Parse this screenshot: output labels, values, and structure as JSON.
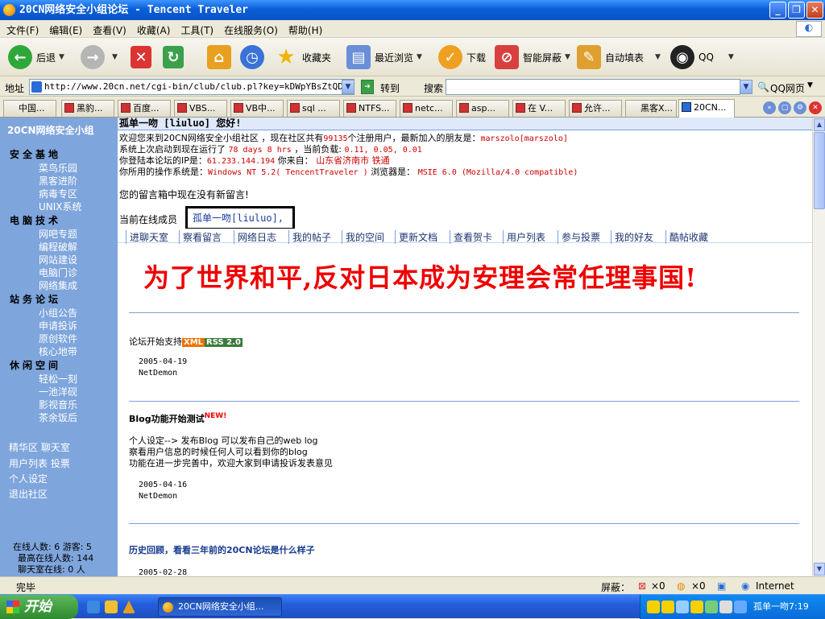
{
  "window": {
    "title": "20CN网络安全小组论坛 - Tencent Traveler",
    "controls": [
      "_",
      "❐",
      "✕"
    ]
  },
  "menu": [
    "文件(F)",
    "编辑(E)",
    "查看(V)",
    "收藏(A)",
    "工具(T)",
    "在线服务(O)",
    "帮助(H)"
  ],
  "toolbar": {
    "back": "后退",
    "favorites": "收藏夹",
    "history": "最近浏览",
    "download": "下载",
    "smartblock": "智能屏蔽",
    "autofill": "自动填表",
    "qq": "QQ"
  },
  "address": {
    "label": "地址",
    "url": "http://www.20cn.net/cgi-bin/club/club.pl?key=kDWpYBsZtQDG",
    "go": "转到",
    "search_label": "搜索",
    "search_value": "",
    "qqpage": "QQ网页"
  },
  "tabs": [
    "中国...",
    "黑豹...",
    "百度...",
    "VBS...",
    "VB中...",
    "sql ...",
    "NTFS...",
    "netc...",
    "asp...",
    "在 V...",
    "允许...",
    "黑客X...",
    "20CN..."
  ],
  "sidebar": {
    "brand": "20CN网络安全小组",
    "sections": [
      {
        "title": "安全基地",
        "items": [
          "菜鸟乐园",
          "黑客进阶",
          "病毒专区",
          "UNIX系统"
        ]
      },
      {
        "title": "电脑技术",
        "items": [
          "网吧专题",
          "编程破解",
          "网站建设",
          "电脑门诊",
          "网络集成"
        ]
      },
      {
        "title": "站务论坛",
        "items": [
          "小组公告",
          "申请投诉",
          "原创软件",
          "核心地带"
        ]
      },
      {
        "title": "休闲空间",
        "items": [
          "轻松一刻",
          "一池洋砚",
          "影视音乐",
          "茶余饭后"
        ]
      }
    ],
    "links": [
      "精华区  聊天室",
      "用户列表  投票",
      "个人设定",
      "退出社区"
    ],
    "stats": [
      "在线人数: 6 游客: 5",
      "最高在线人数: 144",
      "聊天室在线:  0 人"
    ]
  },
  "main": {
    "greeting": "孤单一吻 [liuluo] 您好!",
    "welcome_prefix": "欢迎您来到20CN网络安全小组社区 ，现在社区共有",
    "member_count": "99135",
    "welcome_mid": "个注册用户，最新加入的朋友是：",
    "newest_member": "marszolo[marszolo]",
    "uptime_label": "系统上次启动到现在运行了",
    "uptime": "78 days 8 hrs",
    "load_label": "，当前负载:",
    "load": "0.11, 0.05, 0.01",
    "ip_label": "你登陆本论坛的IP是：",
    "ip": "61.233.144.194",
    "from_label": "你来自：",
    "location": "山东省济南市 铁通",
    "os_label": "你所用的操作系统是：",
    "os": "Windows NT 5.2( TencentTraveler )",
    "browser_label": "浏览器是：",
    "browser": "MSIE 6.0 (Mozilla/4.0 compatible)",
    "mailbox": "您的留言箱中现在没有新留言!",
    "online_label": "当前在线成员",
    "online_user": "孤单一吻[liuluo],",
    "nav": [
      "进聊天室",
      "察看留言",
      "网络日志",
      "我的帖子",
      "我的空间",
      "更新文档",
      "查看贺卡",
      "用户列表",
      "参与投票",
      "我的好友",
      "酷帖收藏"
    ],
    "slogan": "为了世界和平,反对日本成为安理会常任理事国!",
    "posts": [
      {
        "title": "论坛开始支持",
        "badge_xml": "XML",
        "badge_rss": "RSS 2.0",
        "date": "2005-04-19",
        "author": "NetDemon"
      },
      {
        "title": "Blog功能开始测试",
        "badge_new": "NEW!",
        "body": [
          "个人设定--> 发布Blog 可以发布自己的web log",
          "察看用户信息的时候任何人可以看到你的blog",
          "功能在进一步完善中，欢迎大家到申请投诉发表意见"
        ],
        "date": "2005-04-16",
        "author": "NetDemon"
      },
      {
        "title": "历史回顾，看看三年前的20CN论坛是什么样子",
        "date": "2005-02-28"
      }
    ]
  },
  "status": {
    "text": "完毕",
    "block_label": "屏蔽：",
    "count1": "×0",
    "count2": "×0",
    "zone": "Internet"
  },
  "taskbar": {
    "start": "开始",
    "item": "20CN网络安全小组...",
    "clock": "孤单一吻7:19"
  }
}
